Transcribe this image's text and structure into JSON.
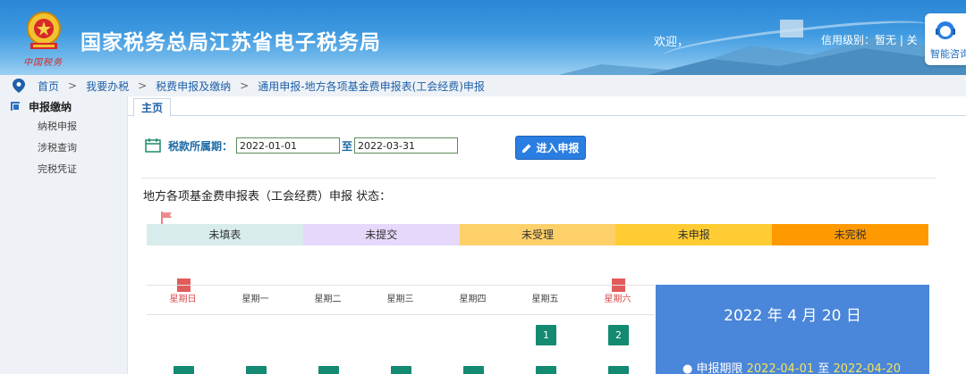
{
  "header": {
    "title": "国家税务总局江苏省电子税务局",
    "emblem_text": "中国税务",
    "welcome": "欢迎，",
    "credit": "信用级别：暂无 | 关",
    "assistant_label": "智能咨询"
  },
  "breadcrumb": {
    "items": [
      "首页",
      "我要办税",
      "税费申报及缴纳",
      "通用申报-地方各项基金费申报表(工会经费)申报"
    ],
    "separator": ">"
  },
  "sidebar": {
    "section": "申报缴纳",
    "items": [
      "纳税申报",
      "涉税查询",
      "完税凭证"
    ]
  },
  "tabs": [
    "主页"
  ],
  "period": {
    "label": "税款所属期：",
    "start": "2022-01-01",
    "to": "至",
    "end": "2022-03-31"
  },
  "enter_button": "进入申报",
  "status_title": "地方各项基金费申报表（工会经费）申报 状态：",
  "statuses": [
    {
      "label": "未填表",
      "color": "#d8ecec"
    },
    {
      "label": "未提交",
      "color": "#e6d8fa"
    },
    {
      "label": "未受理",
      "color": "#fdd06a"
    },
    {
      "label": "未申报",
      "color": "#ffcc33"
    },
    {
      "label": "未完税",
      "color": "#ff9900"
    }
  ],
  "calendar": {
    "weekdays": [
      "星期日",
      "星期一",
      "星期二",
      "星期三",
      "星期四",
      "星期五",
      "星期六"
    ],
    "days": [
      "1",
      "2"
    ]
  },
  "date_panel": {
    "date": "2022 年 4 月 20 日",
    "deadline_label": "● 申报期限",
    "deadline_start": "2022-04-01",
    "deadline_to": "至",
    "deadline_end": "2022-04-20"
  },
  "colors": {
    "accent": "#2a7de1",
    "calendar_day": "#148a72",
    "weekend": "#d94b4b",
    "date_panel": "#4a86d9"
  }
}
